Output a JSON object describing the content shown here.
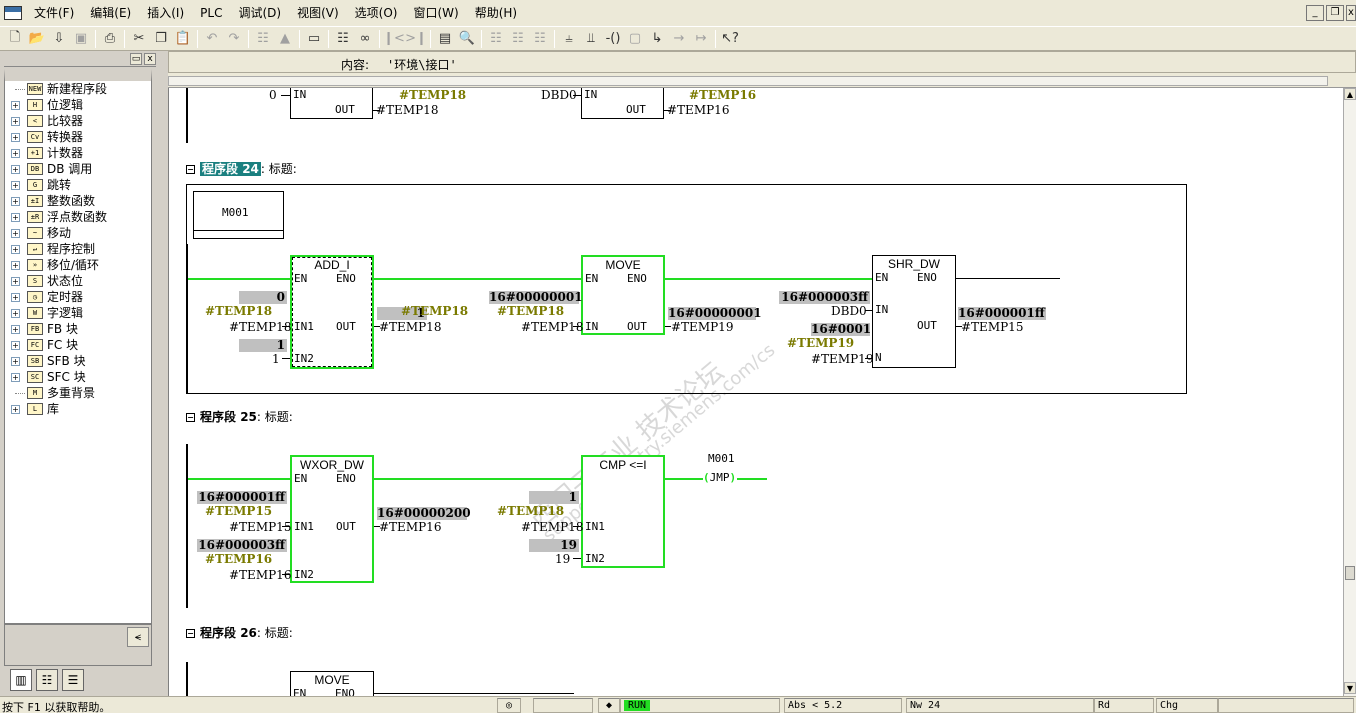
{
  "menu": [
    "文件(F)",
    "编辑(E)",
    "插入(I)",
    "PLC",
    "调试(D)",
    "视图(V)",
    "选项(O)",
    "窗口(W)",
    "帮助(H)"
  ],
  "window_controls": [
    "_",
    "❐",
    "x"
  ],
  "toolbar_icons": [
    "new-file-icon",
    "open-folder-icon",
    "download-icon",
    "save-icon",
    "print-icon",
    "cut-icon",
    "copy-icon",
    "paste-icon",
    "undo-icon",
    "redo-icon",
    "compile-icon",
    "load-icon",
    "overview-icon",
    "monitor-icon",
    "glasses-icon",
    "first-network-icon",
    "last-network-icon",
    "layout-icon",
    "zoom-icon",
    "net-insert-icon",
    "branch-icon",
    "parallel-icon",
    "no-contact-icon",
    "nc-contact-icon",
    "coil-icon",
    "box-icon",
    "branch-open-icon",
    "branch-close-icon",
    "arrow-icon",
    "help-icon"
  ],
  "tree": [
    {
      "label": "新建程序段",
      "icon": "NEW",
      "expandable": false
    },
    {
      "label": "位逻辑",
      "icon": "H",
      "expandable": true
    },
    {
      "label": "比较器",
      "icon": "<",
      "expandable": true
    },
    {
      "label": "转换器",
      "icon": "Cv",
      "expandable": true
    },
    {
      "label": "计数器",
      "icon": "+1",
      "expandable": true
    },
    {
      "label": "DB 调用",
      "icon": "DB",
      "expandable": true
    },
    {
      "label": "跳转",
      "icon": "G",
      "expandable": true
    },
    {
      "label": "整数函数",
      "icon": "±I",
      "expandable": true
    },
    {
      "label": "浮点数函数",
      "icon": "±R",
      "expandable": true
    },
    {
      "label": "移动",
      "icon": "~",
      "expandable": true
    },
    {
      "label": "程序控制",
      "icon": "↵",
      "expandable": true
    },
    {
      "label": "移位/循环",
      "icon": "»",
      "expandable": true
    },
    {
      "label": "状态位",
      "icon": "S",
      "expandable": true
    },
    {
      "label": "定时器",
      "icon": "◷",
      "expandable": true
    },
    {
      "label": "字逻辑",
      "icon": "W",
      "expandable": true
    },
    {
      "label": "FB 块",
      "icon": "FB",
      "expandable": true
    },
    {
      "label": "FC 块",
      "icon": "FC",
      "expandable": true
    },
    {
      "label": "SFB 块",
      "icon": "SB",
      "expandable": true
    },
    {
      "label": "SFC 块",
      "icon": "SC",
      "expandable": true
    },
    {
      "label": "多重背景",
      "icon": "M",
      "expandable": false
    },
    {
      "label": "库",
      "icon": "L",
      "expandable": true
    }
  ],
  "left_tabs": [
    "program-elements-tab",
    "call-structure-tab",
    "list-tab"
  ],
  "info": {
    "label": "内容:",
    "value": "'环境\\接口'"
  },
  "top_fragment": {
    "in_left": "0",
    "out_left": "#TEMP18",
    "out_left_status": "#TEMP18",
    "in_right": "DBD0",
    "out_right": "#TEMP16",
    "out_right_status": "#TEMP16"
  },
  "networks": [
    {
      "label_prefix": "程序段",
      "number": "24",
      "suffix": ": 标题:",
      "selected": true,
      "coil_label": "M001",
      "add": {
        "title": "ADD_I",
        "en": "EN",
        "eno": "ENO",
        "in1": "IN1",
        "in2": "IN2",
        "out": "OUT",
        "in1_val": "0",
        "in1_sym_status": "#TEMP18",
        "in1_var": "#TEMP18",
        "in2_val": "1",
        "in2_var": "1",
        "out_val": "1",
        "out_sym_status": "#TEMP18",
        "out_var": "#TEMP18"
      },
      "move": {
        "title": "MOVE",
        "en": "EN",
        "eno": "ENO",
        "in": "IN",
        "out": "OUT",
        "in_val": "16#00000001",
        "in_sym_status": "#TEMP18",
        "in_var": "#TEMP18",
        "out_val": "16#00000001",
        "out_var": "#TEMP19"
      },
      "shr": {
        "title": "SHR_DW",
        "en": "EN",
        "eno": "ENO",
        "in": "IN",
        "n": "N",
        "out": "OUT",
        "in_val": "16#000003ff",
        "in_var": "DBD0",
        "n_val": "16#0001",
        "n_sym_status": "#TEMP19",
        "n_var": "#TEMP19",
        "out_val": "16#000001ff",
        "out_var": "#TEMP15"
      }
    },
    {
      "label_prefix": "程序段",
      "number": "25",
      "suffix": ": 标题:",
      "selected": false,
      "wxor": {
        "title": "WXOR_DW",
        "en": "EN",
        "eno": "ENO",
        "in1": "IN1",
        "in2": "IN2",
        "out": "OUT",
        "in1_val": "16#000001ff",
        "in1_sym_status": "#TEMP15",
        "in1_var": "#TEMP15",
        "in2_val": "16#000003ff",
        "in2_sym_status": "#TEMP16",
        "in2_var": "#TEMP16",
        "out_val": "16#00000200",
        "out_var": "#TEMP16"
      },
      "cmp": {
        "title": "CMP <=I",
        "in1": "IN1",
        "in2": "IN2",
        "in1_val": "1",
        "in1_sym_status": "#TEMP18",
        "in1_var": "#TEMP18",
        "in2_val": "19",
        "in2_var": "19"
      },
      "jmp": {
        "label": "M001",
        "coil": "JMP"
      }
    },
    {
      "label_prefix": "程序段",
      "number": "26",
      "suffix": ": 标题:",
      "selected": false,
      "move": {
        "title": "MOVE",
        "en": "EN",
        "eno": "ENO"
      }
    }
  ],
  "watermark": {
    "line1": "西门子工业 技术论坛",
    "line2": "support.industry.siemens.com/cs"
  },
  "statusbar": {
    "help": "按下 F1 以获取帮助。",
    "run": "RUN",
    "abs": "Abs < 5.2",
    "nw": "Nw 24",
    "rd": "Rd",
    "chg": "Chg"
  },
  "colors": {
    "ladder_active": "#22dd22",
    "status_bg": "#c0c0c0",
    "status_symbol": "#7a7a00",
    "selected_net_bg": "#1a7f7f"
  }
}
